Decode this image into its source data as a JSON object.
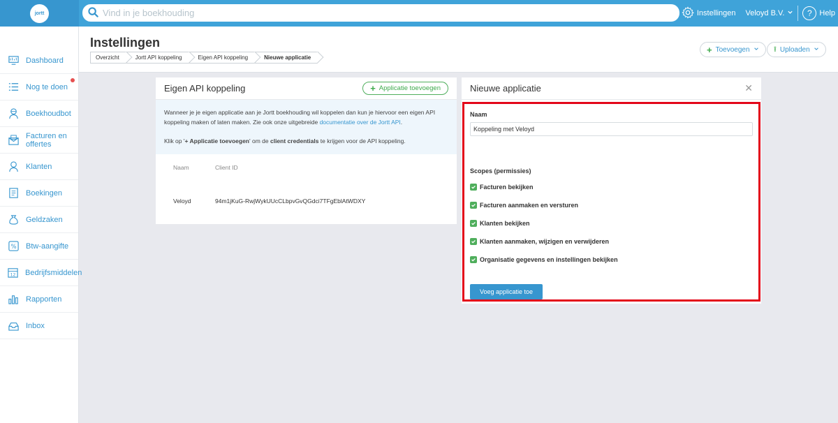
{
  "topbar": {
    "logo_text": "jortt",
    "search_placeholder": "Vind in je boekhouding",
    "settings_label": "Instellingen",
    "company_label": "Veloyd B.V.",
    "help_label": "Help"
  },
  "sidebar": {
    "items": [
      {
        "label": "Dashboard",
        "icon": "dashboard-icon"
      },
      {
        "label": "Nog te doen",
        "icon": "list-icon"
      },
      {
        "label": "Boekhoudbot",
        "icon": "bot-icon"
      },
      {
        "label": "Facturen en offertes",
        "icon": "invoice-icon"
      },
      {
        "label": "Klanten",
        "icon": "customers-icon"
      },
      {
        "label": "Boekingen",
        "icon": "bookings-icon"
      },
      {
        "label": "Geldzaken",
        "icon": "money-icon"
      },
      {
        "label": "Btw-aangifte",
        "icon": "percent-icon"
      },
      {
        "label": "Bedrijfsmiddelen",
        "icon": "calendar-icon"
      },
      {
        "label": "Rapporten",
        "icon": "chart-icon"
      },
      {
        "label": "Inbox",
        "icon": "inbox-icon"
      }
    ]
  },
  "header": {
    "title": "Instellingen",
    "breadcrumbs": [
      "Overzicht",
      "Jortt API koppeling",
      "Eigen API koppeling",
      "Nieuwe applicatie"
    ],
    "add_button": "Toevoegen",
    "upload_button": "Uploaden"
  },
  "left_panel": {
    "title": "Eigen API koppeling",
    "add_app_button": "Applicatie toevoegen",
    "info_line1_pre": "Wanneer je je eigen applicatie aan je Jortt boekhouding wil koppelen dan kun je hiervoor een eigen API koppeling maken of laten maken. Zie ook onze uitgebreide ",
    "info_link": "documentatie over de Jortt API",
    "info_line1_post": ".",
    "info_line2_pre": "Klik op '",
    "info_line2_bold1": "+ Applicatie toevoegen",
    "info_line2_mid": "' om de ",
    "info_line2_bold2": "client credentials",
    "info_line2_post": " te krijgen voor de API koppeling.",
    "table": {
      "headers": [
        "Naam",
        "Client ID"
      ],
      "rows": [
        [
          "Veloyd",
          "94m1jKuG-RwjWykUUcCLbpvGvQGdci7TFgEblAtWDXY"
        ]
      ]
    }
  },
  "right_panel": {
    "title": "Nieuwe applicatie",
    "name_label": "Naam",
    "name_value": "Koppeling met Veloyd",
    "scopes_label": "Scopes (permissies)",
    "scopes": [
      {
        "label": "Facturen bekijken",
        "checked": true
      },
      {
        "label": "Facturen aanmaken en versturen",
        "checked": true
      },
      {
        "label": "Klanten bekijken",
        "checked": true
      },
      {
        "label": "Klanten aanmaken, wijzigen en verwijderen",
        "checked": true
      },
      {
        "label": "Organisatie gegevens en instellingen bekijken",
        "checked": true
      }
    ],
    "submit_button": "Voeg applicatie toe"
  },
  "colors": {
    "brand_blue": "#3fa3d9",
    "accent_green": "#4fae5c",
    "highlight_red": "#e3071a"
  }
}
